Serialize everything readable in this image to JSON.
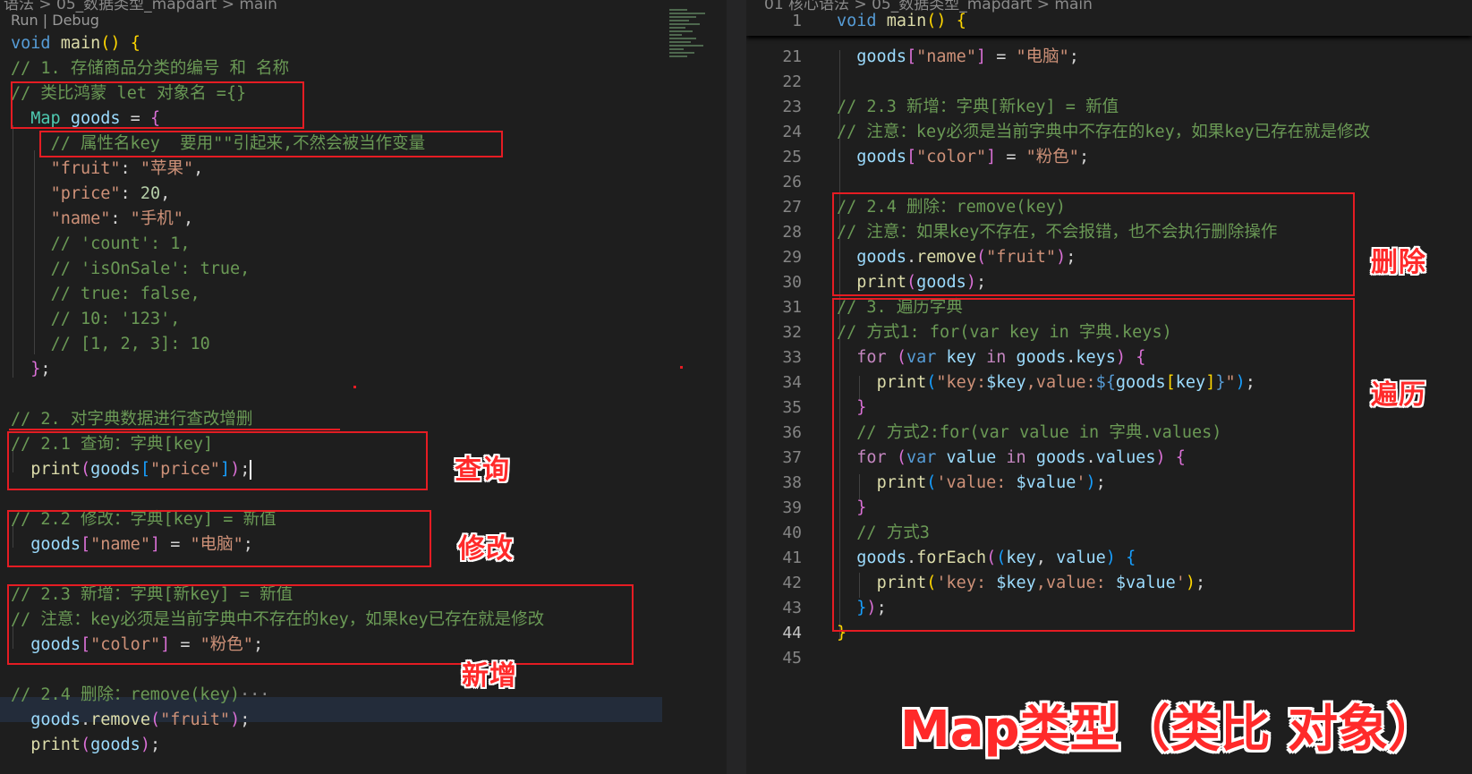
{
  "left": {
    "breadcrumb": "语法 > 05_数据类型_mapdart > main",
    "codelens": "Run | Debug",
    "annotations": {
      "query": "查询",
      "modify": "修改",
      "add": "新增"
    }
  },
  "right": {
    "breadcrumb": "01 核心语法 > 05_数据类型_mapdart > main",
    "annotations": {
      "delete": "删除",
      "iterate": "遍历"
    },
    "title": "Map类型（类比 对象）",
    "sticky_line_number": "1",
    "line_numbers": [
      "21",
      "22",
      "23",
      "24",
      "25",
      "26",
      "27",
      "28",
      "29",
      "30",
      "31",
      "32",
      "33",
      "34",
      "35",
      "36",
      "37",
      "38",
      "39",
      "40",
      "41",
      "42",
      "43",
      "44",
      "45"
    ]
  },
  "colors": {
    "annotation_red": "#e51c23",
    "editor_bg": "#1e1e1e",
    "comment_green": "#6a9955",
    "string_orange": "#ce9178",
    "keyword_blue": "#569cd6",
    "variable_lightblue": "#9cdcfe",
    "function_yellow": "#dcdcaa"
  }
}
